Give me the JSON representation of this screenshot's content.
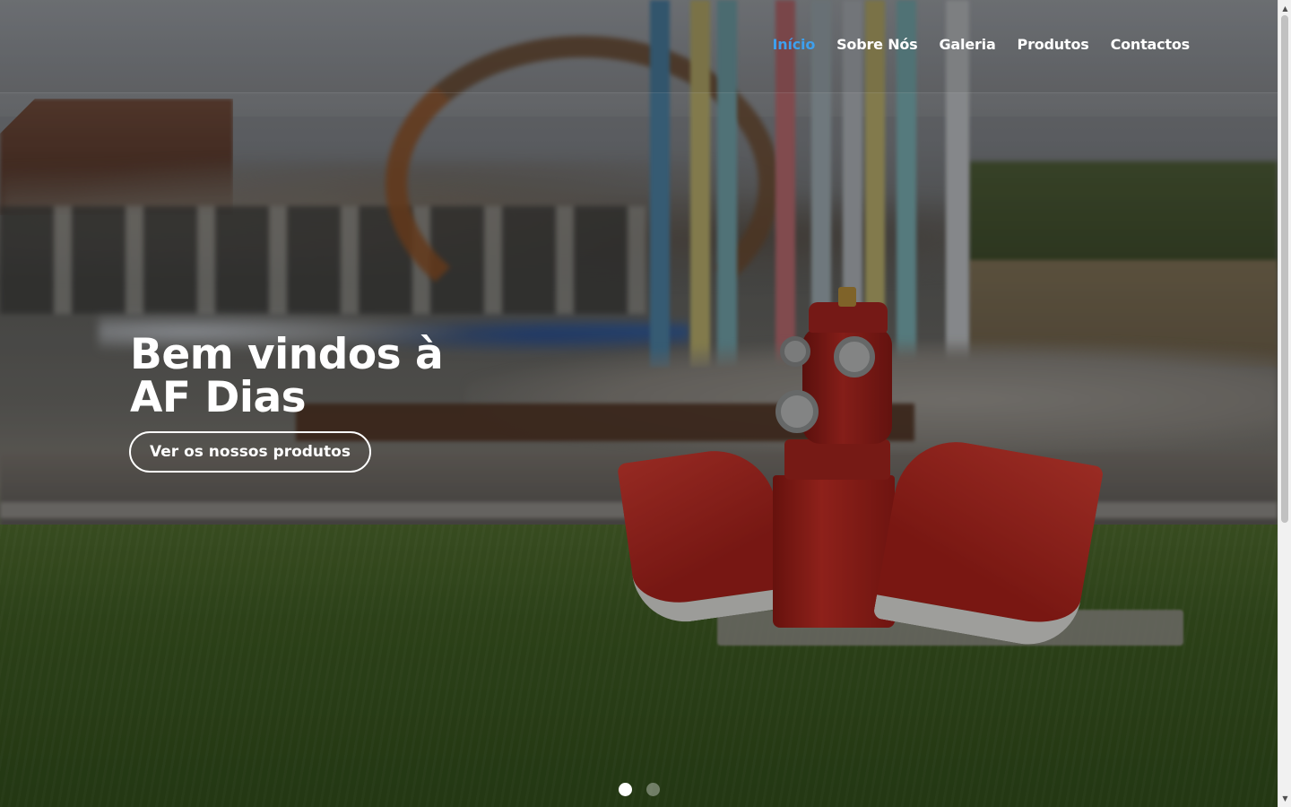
{
  "nav": {
    "items": [
      {
        "label": "Início",
        "active": true
      },
      {
        "label": "Sobre Nós",
        "active": false
      },
      {
        "label": "Galeria",
        "active": false
      },
      {
        "label": "Produtos",
        "active": false
      },
      {
        "label": "Contactos",
        "active": false
      }
    ],
    "active_color": "#3ea0ee"
  },
  "hero": {
    "title_line1": "Bem vindos à",
    "title_line2": "AF Dias",
    "cta_label": "Ver os nossos produtos"
  },
  "slider": {
    "slide_count": 2,
    "active_index": 0
  },
  "scrollbar": {
    "up_icon": "scroll-up-arrow-icon",
    "down_icon": "scroll-down-arrow-icon"
  }
}
